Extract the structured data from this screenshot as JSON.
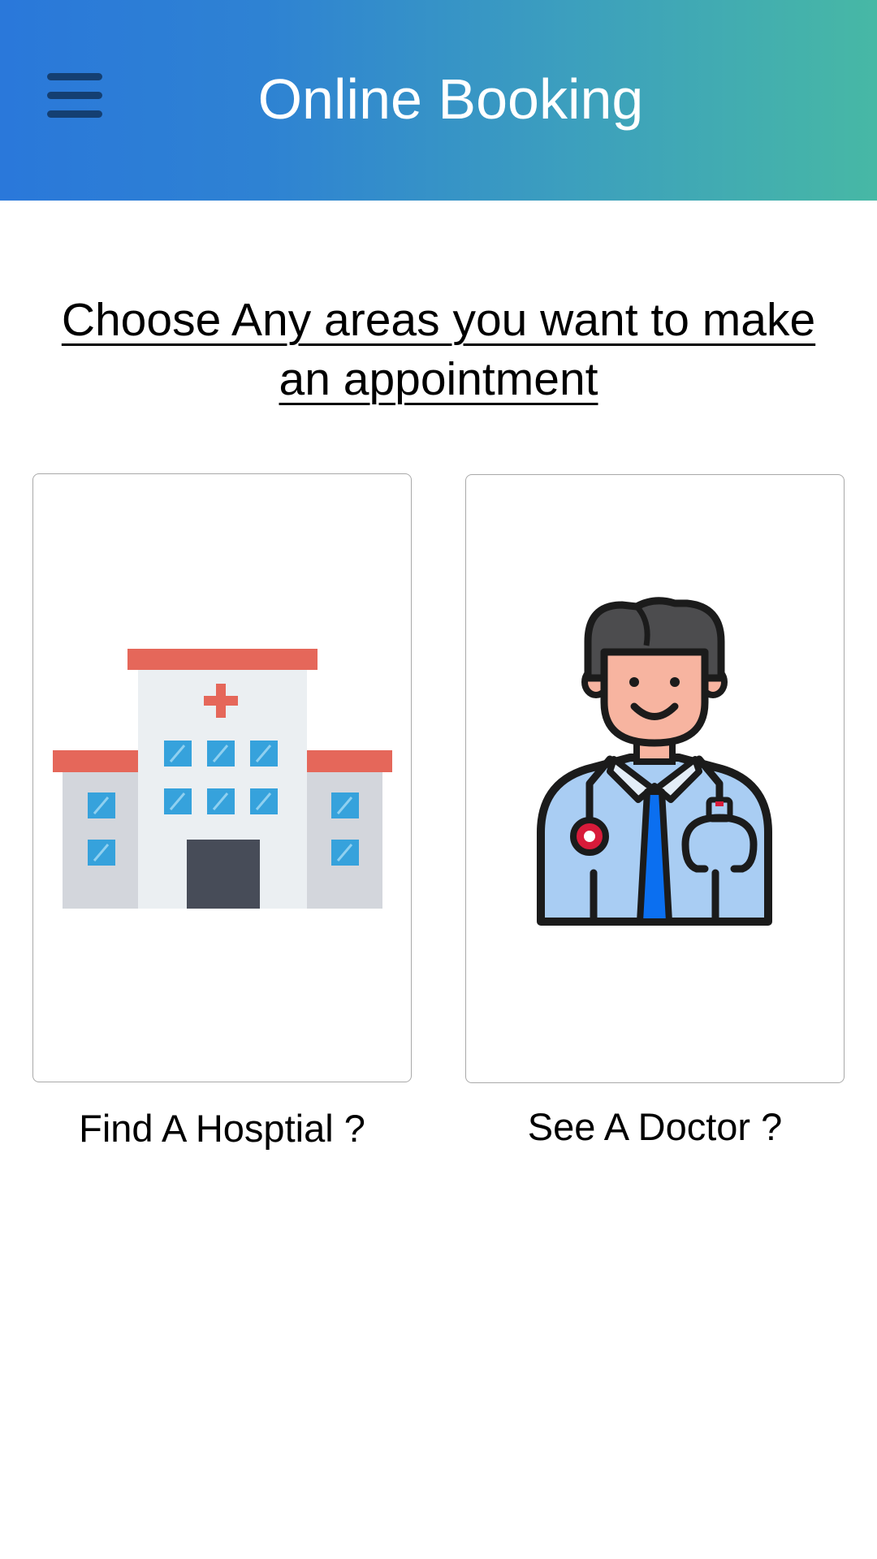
{
  "header": {
    "title": "Online Booking",
    "menu_icon": "hamburger-menu-icon",
    "gradient_colors": [
      "#2a78da",
      "#47b8a5"
    ]
  },
  "prompt": {
    "text": "Choose Any areas you want to make an appointment"
  },
  "options": [
    {
      "label": "Find A Hosptial ?",
      "icon": "hospital-icon"
    },
    {
      "label": "See A Doctor ?",
      "icon": "doctor-icon"
    }
  ]
}
